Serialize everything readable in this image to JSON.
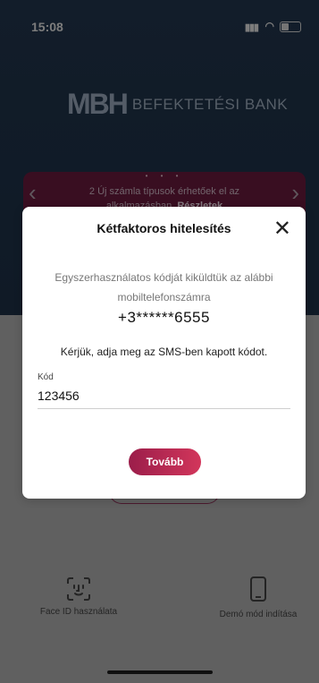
{
  "status": {
    "time": "15:08",
    "signal": "▮▮▮",
    "wifi": "◠"
  },
  "logo": {
    "mark": "MBH",
    "text": "BEFEKTETÉSI BANK"
  },
  "banner": {
    "text": "2 Új számla típusok érhetőek el az alkalmazásban.",
    "link": "Részletek"
  },
  "modal": {
    "title": "Kétfaktoros hitelesítés",
    "description": "Egyszerhasználatos kódját kiküldtük az alábbi mobiltelefonszámra",
    "phone": "+3******6555",
    "prompt": "Kérjük, adja meg az SMS-ben kapott kódot.",
    "field_label": "Kód",
    "field_value": "123456",
    "next_label": "Tovább"
  },
  "quick": {
    "face_id": "Face ID használata",
    "demo": "Demó mód indítása"
  },
  "colors": {
    "accent": "#c02c55",
    "banner": "#5c1836",
    "top_bg": "#1d2f44"
  }
}
